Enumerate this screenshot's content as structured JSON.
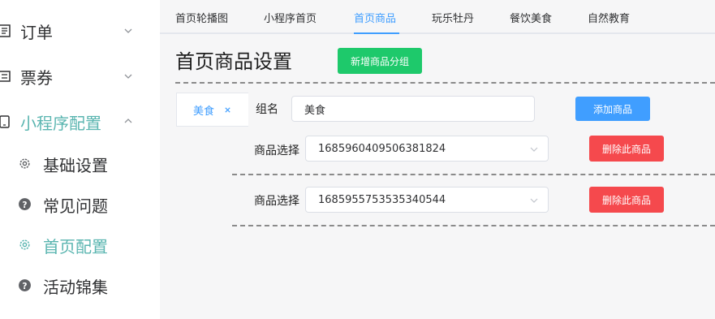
{
  "sidebar": {
    "menus": [
      {
        "label": "订单",
        "icon": "document-icon"
      },
      {
        "label": "票券",
        "icon": "ticket-icon"
      },
      {
        "label": "小程序配置",
        "icon": "tablet-icon"
      }
    ],
    "subitems": [
      {
        "label": "基础设置",
        "icon": "gear-icon"
      },
      {
        "label": "常见问题",
        "icon": "question-circle-icon"
      },
      {
        "label": "首页配置",
        "icon": "gear-icon"
      },
      {
        "label": "活动锦集",
        "icon": "question-circle-icon"
      }
    ],
    "active_color": "#5ab5b0"
  },
  "tabs": [
    "首页轮播图",
    "小程序首页",
    "首页商品",
    "玩乐牡丹",
    "餐饮美食",
    "自然教育"
  ],
  "active_tab": "首页商品",
  "page": {
    "title": "首页商品设置",
    "add_group_button": "新增商品分组"
  },
  "group": {
    "tab_label": "美食",
    "name_label": "组名",
    "name_value": "美食",
    "add_product_button": "添加商品",
    "products": [
      {
        "label": "商品选择",
        "value": "1685960409506381824",
        "delete_button": "删除此商品"
      },
      {
        "label": "商品选择",
        "value": "1685955753535340544",
        "delete_button": "删除此商品"
      }
    ]
  },
  "colors": {
    "primary": "#409eff",
    "success": "#1ec96b",
    "danger": "#f5494d"
  }
}
